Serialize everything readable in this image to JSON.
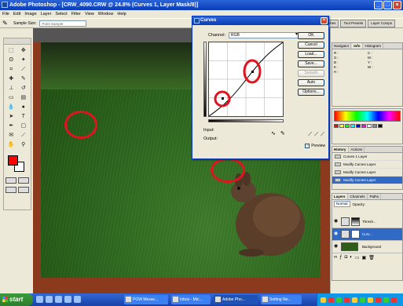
{
  "app": {
    "title": "Adobe Photoshop - [CRW_4090.CRW @ 24.8% (Curves 1, Layer Mask/8)]",
    "menu": [
      "File",
      "Edit",
      "Image",
      "Layer",
      "Select",
      "Filter",
      "View",
      "Window",
      "Help"
    ],
    "options": {
      "sample_size_label": "Sample Size:",
      "sample_size_value": "Point Sample"
    },
    "palette_tabs": [
      "Brushes",
      "Tool Presets",
      "Layer Comps"
    ]
  },
  "curves_dialog": {
    "title": "Curves",
    "channel_label": "Channel:",
    "channel_value": "RGB",
    "input_label": "Input:",
    "output_label": "Output:",
    "buttons": {
      "ok": "OK",
      "cancel": "Cancel",
      "load": "Load...",
      "save": "Save...",
      "smooth": "Smooth",
      "auto": "Auto",
      "options": "Options..."
    },
    "preview_label": "Preview"
  },
  "panels": {
    "navigator_tabs": [
      "Navigator",
      "Info",
      "Histogram"
    ],
    "info": [
      "R :",
      "G :",
      "B :",
      "C :",
      "M :",
      "Y :",
      "K :",
      "W :",
      "H :"
    ],
    "history_tabs": [
      "History",
      "Actions"
    ],
    "history_items": [
      "Curves 1 Layer",
      "Modify Curves Layer",
      "Modify Curves Layer",
      "Modify Curves Layer"
    ],
    "layers_tabs": [
      "Layers",
      "Channels",
      "Paths"
    ],
    "blend_mode": "Normal",
    "opacity_label": "Opacity:",
    "layers": [
      {
        "name": "Thresh..."
      },
      {
        "name": "Curv..."
      },
      {
        "name": "Background"
      }
    ]
  },
  "taskbar": {
    "start_label": "start",
    "tasks": [
      "POW Messe...",
      "Inbox - Mic...",
      "Adobe Pho...",
      "Setting Ne..."
    ]
  },
  "colors": {
    "foreground": "#ff0000",
    "background": "#ffffff",
    "annotation": "#e0141e",
    "selection": "#316ac5"
  }
}
